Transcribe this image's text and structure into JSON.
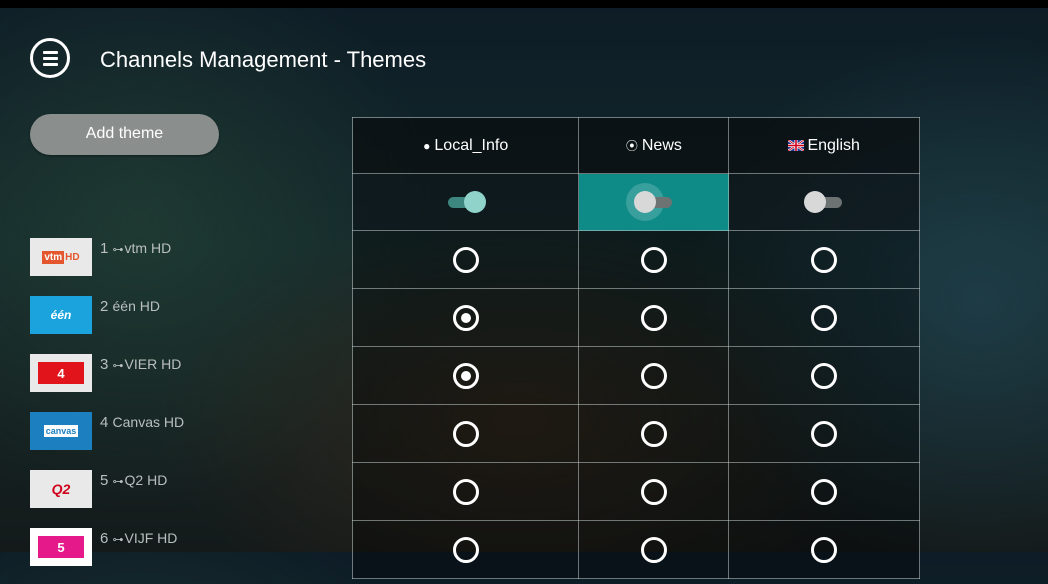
{
  "header": {
    "title": "Channels Management - Themes"
  },
  "actions": {
    "add_theme_label": "Add theme"
  },
  "themes": [
    {
      "label": "Local_Info",
      "icon": "info-icon",
      "enabled": true
    },
    {
      "label": "News",
      "icon": "broadcast-icon",
      "enabled": false,
      "focused": true
    },
    {
      "label": "English",
      "icon": "uk-flag-icon",
      "enabled": false
    }
  ],
  "channels": [
    {
      "number": "1",
      "locked": true,
      "name": "vtm HD",
      "logo_text": "vtm HD",
      "selections": [
        false,
        false,
        false
      ]
    },
    {
      "number": "2",
      "locked": false,
      "name": "één HD",
      "logo_text": "één",
      "selections": [
        true,
        false,
        false
      ]
    },
    {
      "number": "3",
      "locked": true,
      "name": "VIER HD",
      "logo_text": "4",
      "selections": [
        true,
        false,
        false
      ]
    },
    {
      "number": "4",
      "locked": false,
      "name": "Canvas HD",
      "logo_text": "canvas",
      "selections": [
        false,
        false,
        false
      ]
    },
    {
      "number": "5",
      "locked": true,
      "name": "Q2 HD",
      "logo_text": "Q2",
      "selections": [
        false,
        false,
        false
      ]
    },
    {
      "number": "6",
      "locked": true,
      "name": "VIJF HD",
      "logo_text": "5",
      "selections": [
        false,
        false,
        false
      ]
    }
  ],
  "colors": {
    "accent": "#0e8a87",
    "toggle_on": "#8fd3cb"
  }
}
